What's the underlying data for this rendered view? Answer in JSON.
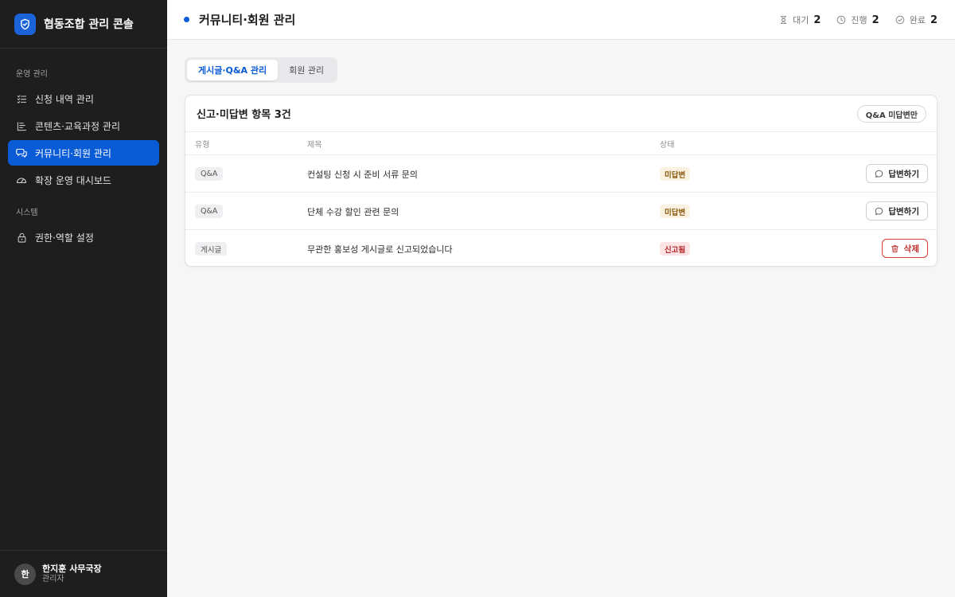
{
  "app": {
    "title": "협동조합 관리 콘솔",
    "logo_icon": "shield-check-icon"
  },
  "sidebar": {
    "sections": [
      {
        "label": "운영 관리",
        "items": [
          {
            "label": "신청 내역 관리",
            "icon": "list-check-icon",
            "active": false
          },
          {
            "label": "콘텐츠·교육과정 관리",
            "icon": "content-list-icon",
            "active": false
          },
          {
            "label": "커뮤니티·회원 관리",
            "icon": "chat-bubbles-icon",
            "active": true
          },
          {
            "label": "확장 운영 대시보드",
            "icon": "gauge-icon",
            "active": false
          }
        ]
      },
      {
        "label": "시스템",
        "items": [
          {
            "label": "권한·역할 설정",
            "icon": "lock-icon",
            "active": false
          }
        ]
      }
    ],
    "user": {
      "avatar_initial": "한",
      "name": "한지훈 사무국장",
      "role": "관리자"
    }
  },
  "header": {
    "title": "커뮤니티·회원 관리",
    "stats": [
      {
        "label": "대기",
        "value": "2",
        "icon": "hourglass-icon"
      },
      {
        "label": "진행",
        "value": "2",
        "icon": "clock-icon"
      },
      {
        "label": "완료",
        "value": "2",
        "icon": "check-circle-icon"
      }
    ]
  },
  "tabs": [
    {
      "label": "게시글·Q&A 관리",
      "active": true
    },
    {
      "label": "회원 관리",
      "active": false
    }
  ],
  "card": {
    "title": "신고·미답변 항목 3건",
    "filter_label": "Q&A 미답변만",
    "columns": {
      "type": "유형",
      "title": "제목",
      "status": "상태"
    },
    "rows": [
      {
        "type": "Q&A",
        "title": "컨설팅 신청 시 준비 서류 문의",
        "status": "미답변",
        "status_kind": "pending",
        "action": "답변하기",
        "action_icon": "chat-icon"
      },
      {
        "type": "Q&A",
        "title": "단체 수강 할인 관련 문의",
        "status": "미답변",
        "status_kind": "pending",
        "action": "답변하기",
        "action_icon": "chat-icon"
      },
      {
        "type": "게시글",
        "title": "무관한 홍보성 게시글로 신고되었습니다",
        "status": "신고됨",
        "status_kind": "reported",
        "action": "삭제",
        "action_icon": "trash-icon"
      }
    ]
  },
  "colors": {
    "accent": "#0a5bd6",
    "sidebar_bg": "#1e1e1e",
    "pending_bg": "#fbf1e0",
    "reported_bg": "#fde3e3",
    "danger": "#c22d2d"
  }
}
